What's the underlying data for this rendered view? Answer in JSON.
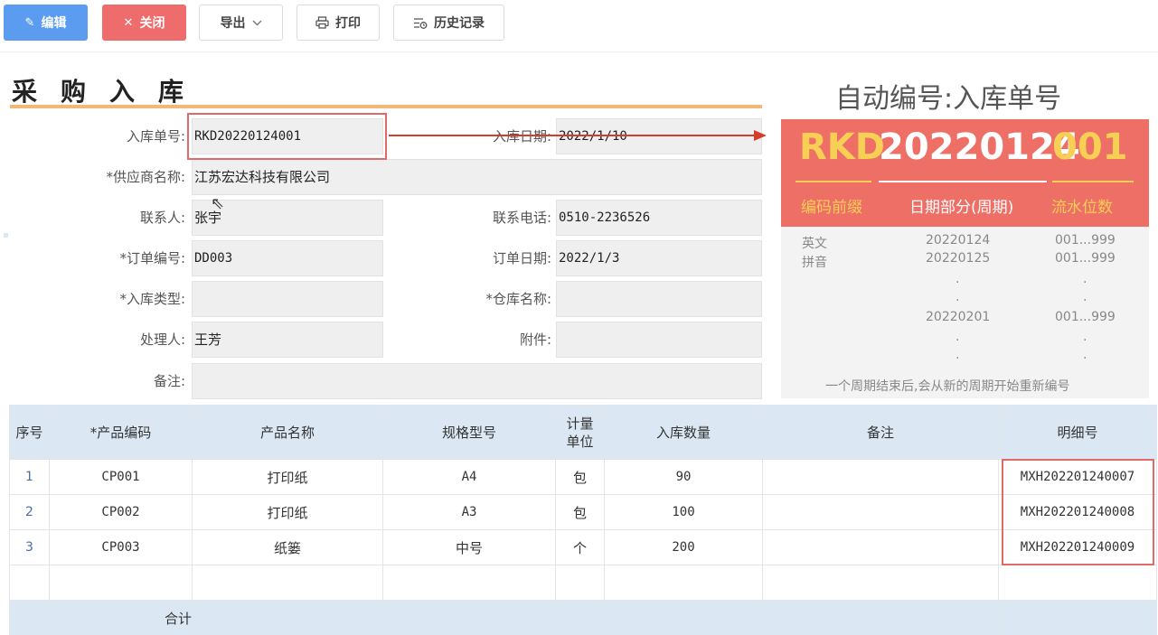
{
  "toolbar": {
    "edit_label": "编辑",
    "close_label": "关闭",
    "export_label": "导出",
    "print_label": "打印",
    "history_label": "历史记录"
  },
  "form": {
    "title": "采购入库",
    "fields": {
      "receipt_no_label": "入库单号:",
      "receipt_no_value": "RKD20220124001",
      "receipt_date_label": "入库日期:",
      "receipt_date_value": "2022/1/10",
      "supplier_label": "*供应商名称:",
      "supplier_value": "江苏宏达科技有限公司",
      "contact_label": "联系人:",
      "contact_value": "张宇",
      "phone_label": "联系电话:",
      "phone_value": "0510-2236526",
      "order_no_label": "*订单编号:",
      "order_no_value": "DD003",
      "order_date_label": "订单日期:",
      "order_date_value": "2022/1/3",
      "receipt_type_label": "*入库类型:",
      "receipt_type_value": "",
      "warehouse_label": "*仓库名称:",
      "warehouse_value": "",
      "handler_label": "处理人:",
      "handler_value": "王芳",
      "attachment_label": "附件:",
      "attachment_value": "",
      "remark_label": "备注:",
      "remark_value": ""
    }
  },
  "annotation": {
    "title": "自动编号:入库单号",
    "code_prefix": "RKD",
    "code_date": "20220124",
    "code_serial": "001",
    "seg_prefix_label": "编码前缀",
    "seg_date_label": "日期部分(周期)",
    "seg_serial_label": "流水位数",
    "prefix_examples": [
      "英文",
      "拼音"
    ],
    "date_examples": [
      "20220124",
      "20220125",
      ".",
      ".",
      "20220201",
      ".",
      "."
    ],
    "serial_examples": [
      "001...999",
      "001...999",
      ".",
      ".",
      "001...999",
      ".",
      "."
    ],
    "footnote": "一个周期结束后,会从新的周期开始重新编号",
    "colors": {
      "red": "#ee6f65",
      "gold": "#f7cf55",
      "highlight": "#e06a6a"
    }
  },
  "table": {
    "headers": [
      "序号",
      "*产品编码",
      "产品名称",
      "规格型号",
      "计量单位",
      "入库数量",
      "备注",
      "明细号"
    ],
    "rows": [
      [
        "1",
        "CP001",
        "打印纸",
        "A4",
        "包",
        "90",
        "",
        "MXH202201240007"
      ],
      [
        "2",
        "CP002",
        "打印纸",
        "A3",
        "包",
        "100",
        "",
        "MXH202201240008"
      ],
      [
        "3",
        "CP003",
        "纸篓",
        "中号",
        "个",
        "200",
        "",
        "MXH202201240009"
      ],
      [
        "",
        "",
        "",
        "",
        "",
        "",
        "",
        ""
      ]
    ],
    "footer_label": "合计"
  }
}
